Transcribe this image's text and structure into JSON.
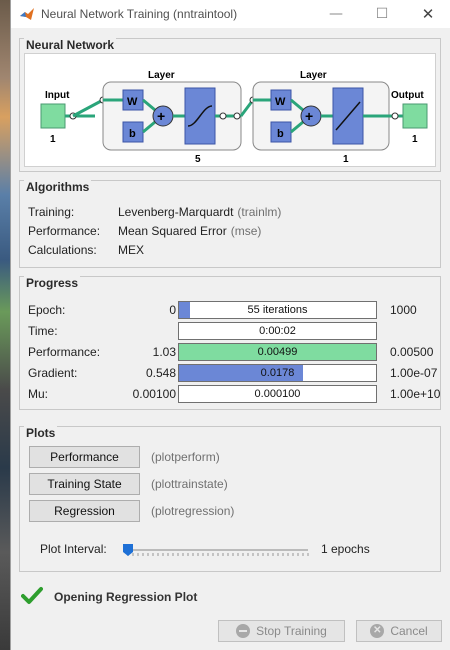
{
  "window": {
    "title": "Neural Network Training (nntraintool)",
    "minimize": "—",
    "maximize": "☐",
    "close": "✕"
  },
  "network": {
    "section_title": "Neural Network",
    "input_label": "Input",
    "input_size": "1",
    "hidden_layer_label": "Layer",
    "hidden_size": "5",
    "output_layer_label": "Layer",
    "output_layer_size": "1",
    "output_label": "Output",
    "output_size": "1",
    "weight_label": "W",
    "bias_label": "b",
    "colors": {
      "node": "#7fdca0",
      "block": "#6b87d6",
      "line": "#2aa57a"
    }
  },
  "algorithms": {
    "section_title": "Algorithms",
    "rows": [
      {
        "label": "Training:",
        "value": "Levenberg-Marquardt",
        "fn": "(trainlm)"
      },
      {
        "label": "Performance:",
        "value": "Mean Squared Error",
        "fn": "(mse)"
      },
      {
        "label": "Calculations:",
        "value": "MEX",
        "fn": ""
      }
    ]
  },
  "progress": {
    "section_title": "Progress",
    "rows": [
      {
        "label": "Epoch:",
        "min": "0",
        "value": "55 iterations",
        "max": "1000",
        "fill": 0.055,
        "color": "#6b87d6"
      },
      {
        "label": "Time:",
        "min": "",
        "value": "0:00:02",
        "max": "",
        "fill": 0,
        "color": "#6b87d6"
      },
      {
        "label": "Performance:",
        "min": "1.03",
        "value": "0.00499",
        "max": "0.00500",
        "fill": 1.0,
        "color": "#7fdca0"
      },
      {
        "label": "Gradient:",
        "min": "0.548",
        "value": "0.0178",
        "max": "1.00e-07",
        "fill": 0.63,
        "color": "#6b87d6"
      },
      {
        "label": "Mu:",
        "min": "0.00100",
        "value": "0.000100",
        "max": "1.00e+10",
        "fill": 0,
        "color": "#6b87d6"
      }
    ]
  },
  "plots": {
    "section_title": "Plots",
    "buttons": [
      {
        "label": "Performance",
        "fn": "(plotperform)"
      },
      {
        "label": "Training State",
        "fn": "(plottrainstate)"
      },
      {
        "label": "Regression",
        "fn": "(plotregression)"
      }
    ],
    "interval_label": "Plot Interval:",
    "interval_value": "1 epochs",
    "interval_fraction": 0.0
  },
  "status": {
    "text": "Opening Regression Plot",
    "icon": "checkmark-icon",
    "color": "#2e9e2e"
  },
  "footer": {
    "stop_label": "Stop Training",
    "cancel_label": "Cancel"
  }
}
